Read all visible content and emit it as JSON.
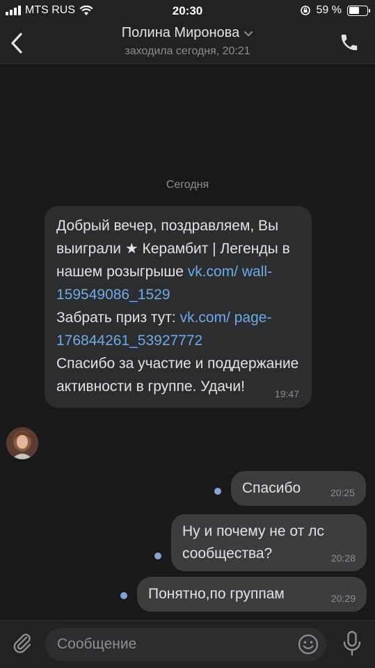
{
  "status_bar": {
    "carrier": "MTS RUS",
    "time": "20:30",
    "battery": "59 %",
    "battery_level": 0.59
  },
  "header": {
    "title": "Полина Миронова",
    "subtitle": "заходила сегодня, 20:21"
  },
  "chat": {
    "date_separator": "Сегодня",
    "incoming": {
      "line1": "Добрый вечер, поздравляем, Вы выиграли ★ Керамбит | Легенды в нашем розыгрыше ",
      "link1": "vk.com/ wall-159549086_1529",
      "line2": "Забрать приз тут: ",
      "link2": "vk.com/ page-176844261_53927772",
      "line3": "Спасибо за участие и поддержание активности в группе. Удачи!",
      "time": "19:47"
    },
    "outgoing": [
      {
        "text": "Спасибо",
        "time": "20:25"
      },
      {
        "text": "Ну и почему не от лс сообщества?",
        "time": "20:28"
      },
      {
        "text": "Понятно,по группам",
        "time": "20:29"
      }
    ]
  },
  "composer": {
    "placeholder": "Сообщение"
  },
  "icons": {
    "back": "chevron-left-icon",
    "dropdown": "chevron-down-icon",
    "call": "phone-icon",
    "attach": "paperclip-icon",
    "emoji": "smiley-icon",
    "voice": "microphone-icon"
  },
  "colors": {
    "background": "#19191a",
    "bar": "#222223",
    "incoming_bubble": "#2c2d2e",
    "outgoing_bubble": "#3d3d3f",
    "link": "#71aaeb",
    "unread_dot": "#7fa6d6"
  }
}
